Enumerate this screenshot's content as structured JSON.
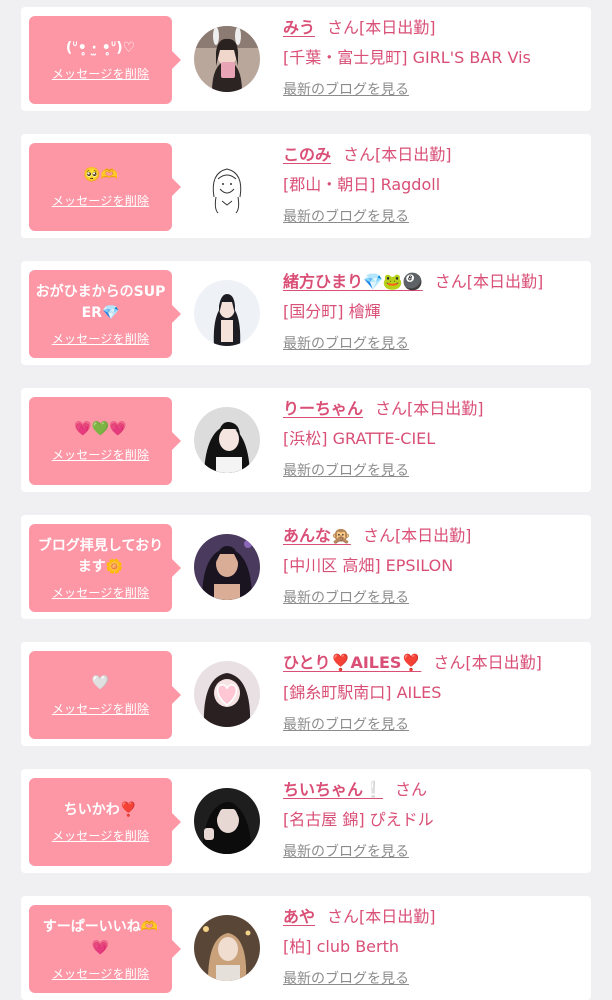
{
  "colors": {
    "bubble": "#fd97a6",
    "name": "#d94f76",
    "muted": "#8c8c8c",
    "background": "#f0f0f2",
    "card": "#ffffff"
  },
  "delete_label": "メッセージを削除",
  "blog_label": "最新のブログを見る",
  "items": [
    {
      "message": "(ᐡ•̥ ·̫ •̥ᐡ)♡",
      "name": "みう",
      "san": "さん[本日出勤]",
      "shop": "[千葉・富士見町] GIRL'S BAR Vis"
    },
    {
      "message": "🥺🫶",
      "name": "このみ",
      "san": "さん[本日出勤]",
      "shop": "[郡山・朝日] Ragdoll"
    },
    {
      "message": "おがひまからのSUPER💎",
      "name": "緒方ひまり💎🐸🎱",
      "san": "さん[本日出勤]",
      "shop": "[国分町] 檜輝"
    },
    {
      "message": "💗💚💗",
      "name": "りーちゃん",
      "san": "さん[本日出勤]",
      "shop": "[浜松] GRATTE-CIEL"
    },
    {
      "message": "ブログ拝見しております🌼",
      "name": "あんな🙊",
      "san": "さん[本日出勤]",
      "shop": "[中川区 高畑] EPSILON"
    },
    {
      "message": "🤍",
      "name": "ひとり❣️AILES❣️",
      "san": "さん[本日出勤]",
      "shop": "[錦糸町駅南口] AILES"
    },
    {
      "message": "ちいかわ❣️",
      "name": "ちいちゃん❕",
      "san": "さん",
      "shop": "[名古屋 錦] ぴえドル"
    },
    {
      "message": "すーぱーいいね🫶💗",
      "name": "あや",
      "san": "さん[本日出勤]",
      "shop": "[柏] club Berth"
    }
  ]
}
